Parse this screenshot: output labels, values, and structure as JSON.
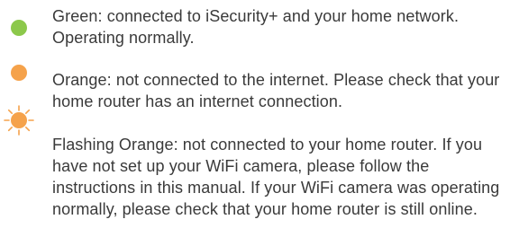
{
  "colors": {
    "green": "#8cc84b",
    "orange": "#f5a24b",
    "text": "#3a3a3a"
  },
  "legend": [
    {
      "icon": "green-dot-icon",
      "text": "Green: connected to iSecurity+ and your home network. Operating normally."
    },
    {
      "icon": "orange-dot-icon",
      "text": "Orange: not connected to the internet. Please check that your home router has an internet connection."
    },
    {
      "icon": "flashing-orange-dot-icon",
      "text": "Flashing Orange: not connected to your home router. If you have not set up your WiFi camera, please follow the instructions in this manual. If your WiFi camera was operating normally, please check that your home router is still online."
    }
  ]
}
